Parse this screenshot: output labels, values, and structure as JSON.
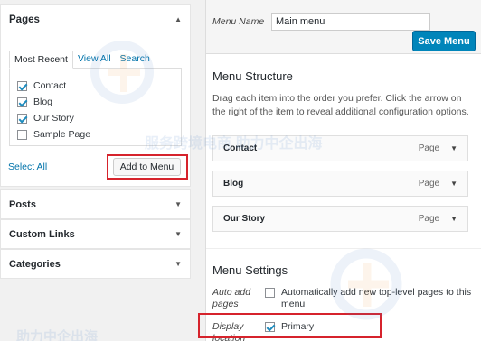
{
  "left_panel": {
    "pages_box": {
      "title": "Pages",
      "tabs": [
        "Most Recent",
        "View All",
        "Search"
      ],
      "items": [
        {
          "label": "Contact",
          "checked": true
        },
        {
          "label": "Blog",
          "checked": true
        },
        {
          "label": "Our Story",
          "checked": true
        },
        {
          "label": "Sample Page",
          "checked": false
        }
      ],
      "select_all": "Select All",
      "add_button": "Add to Menu"
    },
    "accordions": [
      "Posts",
      "Custom Links",
      "Categories"
    ]
  },
  "right_panel": {
    "menu_name_label": "Menu Name",
    "menu_name_value": "Main menu",
    "save_button": "Save Menu",
    "structure_title": "Menu Structure",
    "structure_desc": "Drag each item into the order you prefer. Click the arrow on the right of the item to reveal additional configuration options.",
    "menu_items": [
      {
        "title": "Contact",
        "type": "Page"
      },
      {
        "title": "Blog",
        "type": "Page"
      },
      {
        "title": "Our Story",
        "type": "Page"
      }
    ],
    "settings_title": "Menu Settings",
    "auto_add_label": "Auto add pages",
    "auto_add_text": "Automatically add new top-level pages to this menu",
    "auto_add_checked": false,
    "display_location_label": "Display location",
    "primary_label": "Primary",
    "primary_checked": true
  },
  "watermark": {
    "text_1": "服务跨境电商 助力中企出海",
    "text_2": "助力中企出海"
  },
  "colors": {
    "accent": "#0073aa",
    "primary_button": "#0085ba",
    "highlight_box": "#d6232c"
  }
}
